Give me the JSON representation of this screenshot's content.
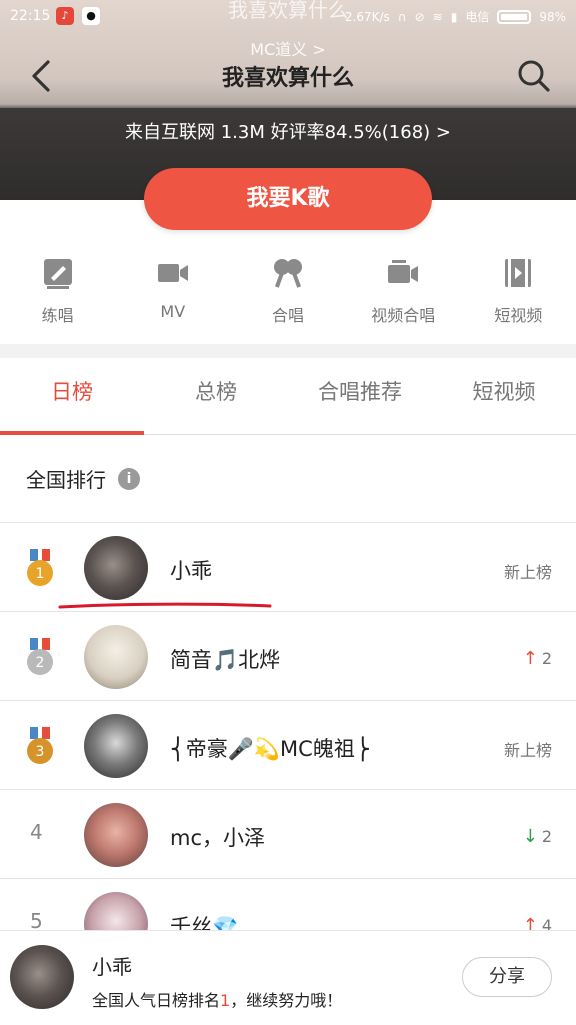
{
  "status_bar": {
    "time": "22:15",
    "speed": "2.67K/s",
    "carrier": "电信",
    "battery": "98%"
  },
  "header": {
    "ghost_title": "我喜欢算什么",
    "ghost_subtitle": "MC道义 >",
    "title": "我喜欢算什么",
    "source_line": "来自互联网  1.3M  好评率84.5%(168) >"
  },
  "primary_button": {
    "label": "我要K歌"
  },
  "modes": [
    {
      "icon": "practice-icon",
      "label": "练唱"
    },
    {
      "icon": "video-camera-icon",
      "label": "MV"
    },
    {
      "icon": "duet-mic-icon",
      "label": "合唱"
    },
    {
      "icon": "video-duet-icon",
      "label": "视频合唱"
    },
    {
      "icon": "short-video-icon",
      "label": "短视频"
    }
  ],
  "tabs": [
    {
      "label": "日榜",
      "active": true
    },
    {
      "label": "总榜",
      "active": false
    },
    {
      "label": "合唱推荐",
      "active": false
    },
    {
      "label": "短视频",
      "active": false
    }
  ],
  "section": {
    "title": "全国排行",
    "info": "i"
  },
  "ranking": [
    {
      "rank": "1",
      "medal": "gold",
      "name": "小乖",
      "trend_text": "新上榜",
      "trend_dir": ""
    },
    {
      "rank": "2",
      "medal": "silver",
      "name": "简音🎵北烨",
      "trend_text": "2",
      "trend_dir": "up"
    },
    {
      "rank": "3",
      "medal": "bronze",
      "name": "⎨帝豪🎤💫MC魄祖⎬",
      "trend_text": "新上榜",
      "trend_dir": ""
    },
    {
      "rank": "4",
      "medal": "",
      "name": "mc，小泽",
      "trend_text": "2",
      "trend_dir": "down"
    },
    {
      "rank": "5",
      "medal": "",
      "name": "千丝💎",
      "trend_text": "4",
      "trend_dir": "up"
    }
  ],
  "bottom_bar": {
    "name": "小乖",
    "message_prefix": "全国人气日榜排名",
    "message_rank": "1",
    "message_suffix": "，继续努力哦！",
    "share_label": "分享"
  },
  "colors": {
    "accent": "#e64d3d",
    "button": "#ef5543",
    "gold": "#e8a42a",
    "silver": "#b9b9b9",
    "bronze": "#d6932a"
  }
}
